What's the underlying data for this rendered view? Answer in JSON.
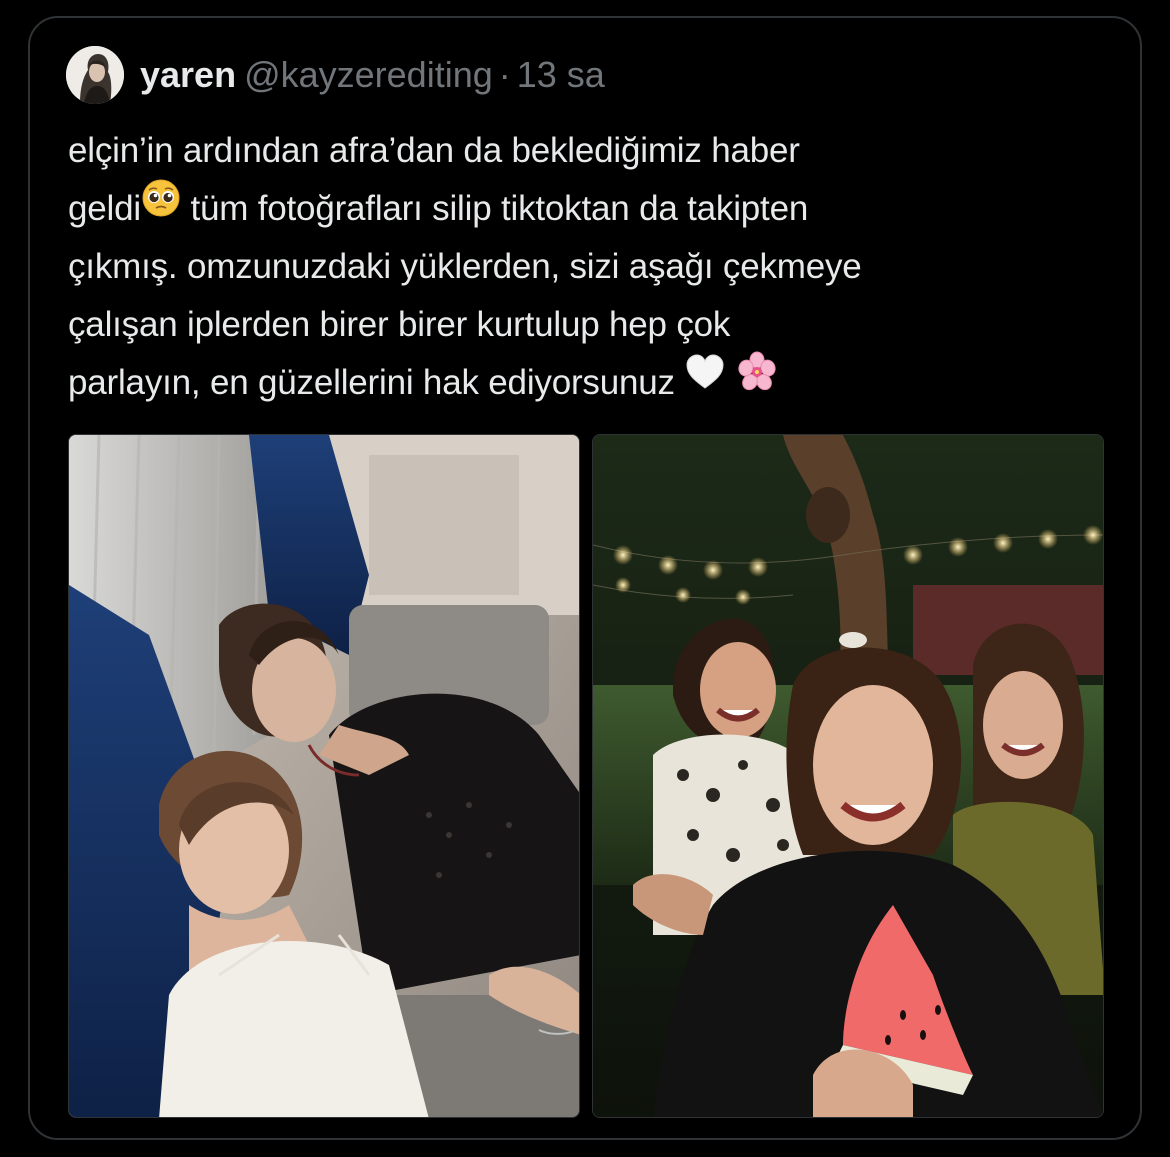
{
  "tweet": {
    "author": {
      "display_name": "yaren",
      "handle": "@kayzerediting"
    },
    "separator": "·",
    "time": "13 sa",
    "text_lines": [
      "elçin’in ardından afra’dan da beklediğimiz haber",
      "geldi",
      " tüm fotoğrafları silip tiktoktan da takipten",
      "çıkmış. omzunuzdaki yüklerden, sizi aşağı çekmeye",
      "çalışan iplerden birer birer kurtulup hep çok",
      "parlayın, en güzellerini hak ediyorsunuz"
    ],
    "emojis": [
      "pleading-face-emoji",
      "white-heart-emoji",
      "cherry-blossom-emoji"
    ],
    "media": [
      {
        "kind": "photo",
        "name": "photo-two-women-on-couch"
      },
      {
        "kind": "photo",
        "name": "photo-friends-night-selfie"
      }
    ]
  },
  "colors": {
    "background": "#000000",
    "text_primary": "#e7e9ea",
    "text_secondary": "#71767b",
    "border": "#2f3336"
  }
}
